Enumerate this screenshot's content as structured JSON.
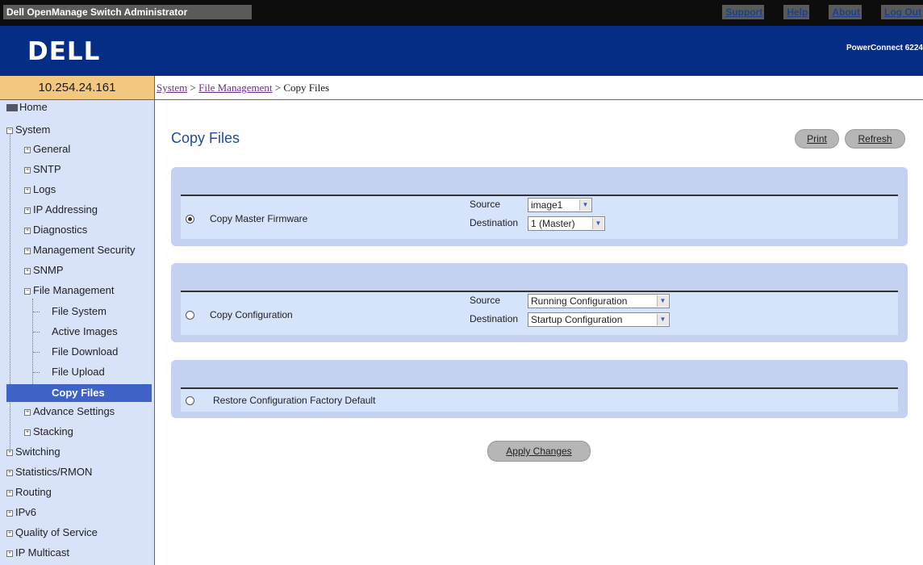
{
  "header": {
    "app_title": "Dell OpenManage Switch Administrator",
    "links": [
      "Support",
      "Help",
      "About",
      "Log Out"
    ],
    "logo": "DELL",
    "model": "PowerConnect 6224"
  },
  "ip_address": "10.254.24.161",
  "breadcrumb": {
    "system": "System",
    "sep1": ">",
    "file_management": "File Management",
    "sep2": ">",
    "current": "Copy Files"
  },
  "sidebar": {
    "items": [
      {
        "label": "Home",
        "icon": "home-icon"
      },
      {
        "label": "System",
        "icon": "collapse-icon"
      },
      {
        "label": "General",
        "icon": "expand-icon"
      },
      {
        "label": "SNTP",
        "icon": "expand-icon"
      },
      {
        "label": "Logs",
        "icon": "expand-icon"
      },
      {
        "label": "IP Addressing",
        "icon": "expand-icon"
      },
      {
        "label": "Diagnostics",
        "icon": "expand-icon"
      },
      {
        "label": "Management Security",
        "icon": "expand-icon"
      },
      {
        "label": "SNMP",
        "icon": "expand-icon"
      },
      {
        "label": "File Management",
        "icon": "collapse-icon"
      },
      {
        "label": "File System",
        "icon": "none"
      },
      {
        "label": "Active Images",
        "icon": "none"
      },
      {
        "label": "File Download",
        "icon": "none"
      },
      {
        "label": "File Upload",
        "icon": "none"
      },
      {
        "label": "Copy Files",
        "icon": "none",
        "active": true
      },
      {
        "label": "Advance Settings",
        "icon": "expand-icon"
      },
      {
        "label": "Stacking",
        "icon": "expand-icon"
      },
      {
        "label": "Switching",
        "icon": "expand-icon"
      },
      {
        "label": "Statistics/RMON",
        "icon": "expand-icon"
      },
      {
        "label": "Routing",
        "icon": "expand-icon"
      },
      {
        "label": "IPv6",
        "icon": "expand-icon"
      },
      {
        "label": "Quality of Service",
        "icon": "expand-icon"
      },
      {
        "label": "IP Multicast",
        "icon": "expand-icon"
      }
    ]
  },
  "main": {
    "title": "Copy Files",
    "print_label": "Print",
    "refresh_label": "Refresh",
    "sections": [
      {
        "label": "Copy Master Firmware",
        "selected": true,
        "source_label": "Source",
        "source_value": "image1",
        "destination_label": "Destination",
        "destination_value": "1 (Master)"
      },
      {
        "label": "Copy Configuration",
        "selected": false,
        "source_label": "Source",
        "source_value": "Running Configuration",
        "destination_label": "Destination",
        "destination_value": "Startup Configuration"
      },
      {
        "label": "Restore Configuration Factory Default",
        "selected": false
      }
    ],
    "apply_label": "Apply Changes"
  },
  "colors": {
    "banner": "#062d86",
    "sidebar": "#d8e2f8",
    "active_item": "#3f62c9",
    "panel": "#c4d1f1",
    "ip_bar": "#f2c77f",
    "title": "#1f4a9e"
  }
}
